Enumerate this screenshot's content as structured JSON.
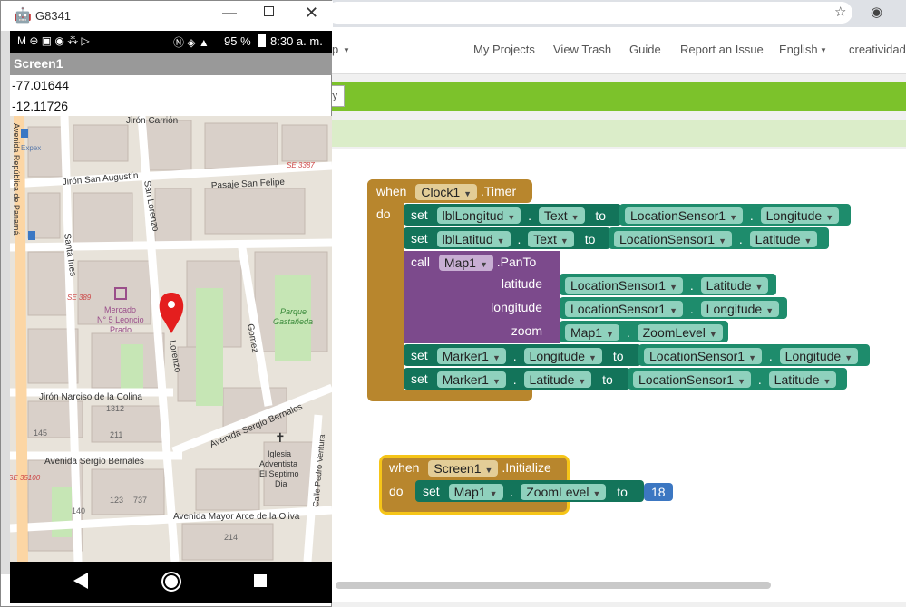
{
  "emulator": {
    "title": "G8341",
    "status": {
      "battery": "95 %",
      "time": "8:30 a. m."
    },
    "app_title": "Screen1",
    "longitude_value": "-77.01644",
    "latitude_value": "-12.11726",
    "map_labels": {
      "jiron_carrion": "Jirón Carrión",
      "expex": "Expex",
      "san_augustin": "Jirón San Augustín",
      "pasaje_san_felipe": "Pasaje San Felipe",
      "san_lorenzo": "San Lorenzo",
      "se_3387": "SE 3387",
      "santa_ines": "Santa Ines",
      "se_389": "SE 389",
      "mercado": "Mercado",
      "mercado_line2": "N° 5 Leoncio",
      "mercado_line3": "Prado",
      "parque": "Parque",
      "parque_line2": "Gastañeda",
      "lorenzo": "Lorenzo",
      "gomez": "Gomez",
      "narciso": "Jirón Narciso de la Colina",
      "n1312": "1312",
      "n145": "145",
      "n211": "211",
      "sergio_bernales_1": "Avenida Sergio Bernales",
      "sergio_bernales_2": "Avenida Sergio Bernales",
      "iglesia": "Iglesia",
      "iglesia_line2": "Adventista",
      "iglesia_line3": "El Septimo",
      "iglesia_line4": "Dia",
      "pedro_ventura": "Calle Pedro Ventura",
      "se_35100": "SE 35100",
      "n123": "123",
      "n737": "737",
      "n140": "140",
      "mayor_arce": "Avenida Mayor Arce de la Oliva",
      "n214": "214",
      "republica_panama": "Avenida República de Panamá"
    }
  },
  "browser": {
    "nav": {
      "my_projects": "My Projects",
      "view_trash": "View Trash",
      "guide": "Guide",
      "report": "Report an Issue",
      "language": "English",
      "user": "creatividad"
    },
    "partial_menu": "p",
    "partial_button": "ry"
  },
  "blocks": {
    "timer": {
      "when": "when",
      "component": "Clock1",
      "event": ".Timer",
      "do": "do",
      "set1": {
        "kw": "set",
        "comp": "lblLongitud",
        "prop": "Text",
        "to": "to",
        "src": "LocationSensor1",
        "src_prop": "Longitude"
      },
      "set2": {
        "kw": "set",
        "comp": "lblLatitud",
        "prop": "Text",
        "to": "to",
        "src": "LocationSensor1",
        "src_prop": "Latitude"
      },
      "call": {
        "kw": "call",
        "comp": "Map1",
        "method": ".PanTo",
        "arg1": "latitude",
        "arg1_src": "LocationSensor1",
        "arg1_prop": "Latitude",
        "arg2": "longitude",
        "arg2_src": "LocationSensor1",
        "arg2_prop": "Longitude",
        "arg3": "zoom",
        "arg3_src": "Map1",
        "arg3_prop": "ZoomLevel"
      },
      "set3": {
        "kw": "set",
        "comp": "Marker1",
        "prop": "Longitude",
        "to": "to",
        "src": "LocationSensor1",
        "src_prop": "Longitude"
      },
      "set4": {
        "kw": "set",
        "comp": "Marker1",
        "prop": "Latitude",
        "to": "to",
        "src": "LocationSensor1",
        "src_prop": "Latitude"
      }
    },
    "init": {
      "when": "when",
      "component": "Screen1",
      "event": ".Initialize",
      "do": "do",
      "set": {
        "kw": "set",
        "comp": "Map1",
        "prop": "ZoomLevel",
        "to": "to",
        "value": "18"
      }
    }
  }
}
